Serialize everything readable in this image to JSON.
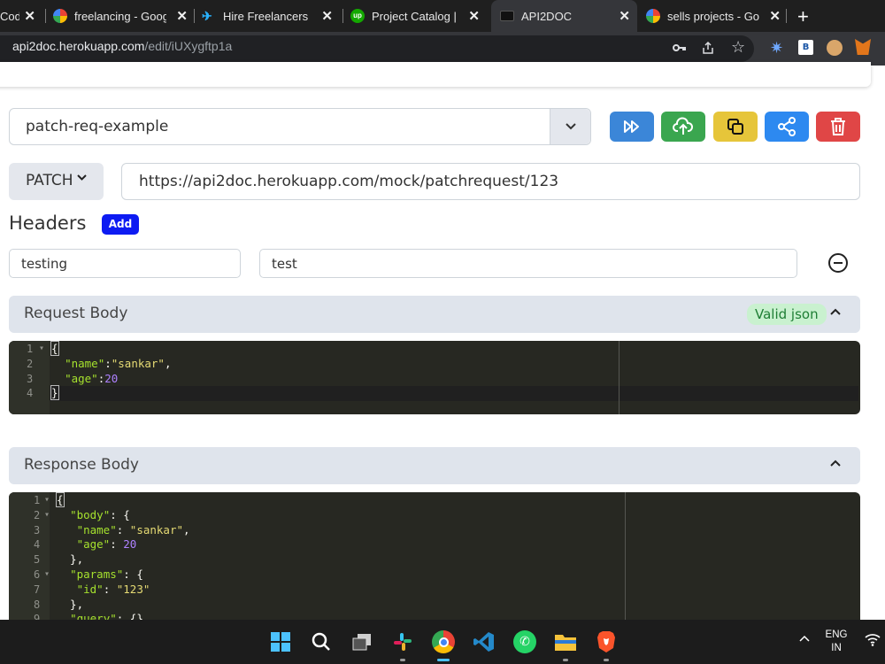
{
  "browser": {
    "tabs": [
      {
        "title": "Codi"
      },
      {
        "title": "freelancing - Goog"
      },
      {
        "title": "Hire Freelancers &"
      },
      {
        "title": "Project Catalog | U"
      },
      {
        "title": "API2DOC"
      },
      {
        "title": "sells projects - Goo"
      }
    ],
    "url_host": "api2doc.herokuapp.com",
    "url_path": "/edit/iUXygftp1a",
    "ext_badge": "B"
  },
  "toolbar": {
    "project_name": "patch-req-example",
    "colors": {
      "run": "#3b86d8",
      "upload": "#3aa64f",
      "copy": "#e6c53a",
      "share": "#2d89f0",
      "delete": "#e04646"
    }
  },
  "request": {
    "method": "PATCH",
    "url": "https://api2doc.herokuapp.com/mock/patchrequest/123"
  },
  "headers": {
    "title": "Headers",
    "add_label": "Add",
    "key": "testing",
    "value": "test"
  },
  "request_body": {
    "title": "Request Body",
    "status": "Valid json",
    "lines": [
      "1",
      "2",
      "3",
      "4"
    ]
  },
  "response_body": {
    "title": "Response Body",
    "lines": [
      "1",
      "2",
      "3",
      "4",
      "5",
      "6",
      "7",
      "8",
      "9"
    ]
  },
  "taskbar": {
    "lang": "ENG",
    "region": "IN"
  }
}
